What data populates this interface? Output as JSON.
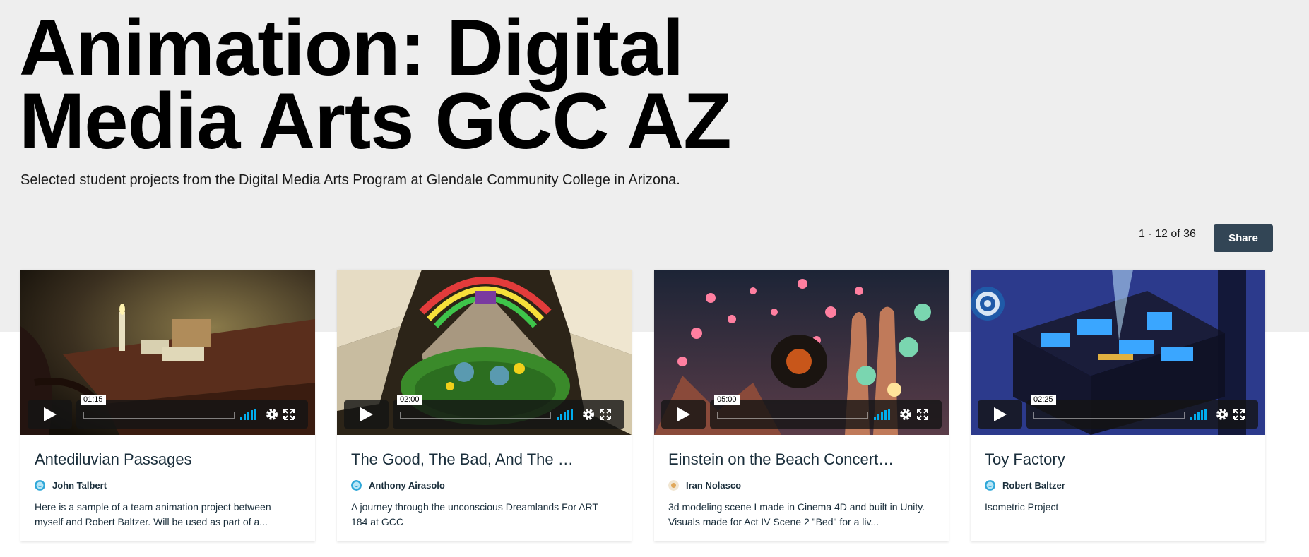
{
  "page": {
    "title": "Animation: Digital Media Arts GCC AZ",
    "description": "Selected student projects from the Digital Media Arts Program at Glendale Community College in Arizona."
  },
  "pagination": {
    "label": "1 - 12 of 36"
  },
  "share": {
    "label": "Share"
  },
  "colors": {
    "accent": "#324555",
    "hero_bg": "#eeeeee",
    "volume": "#00adef"
  },
  "videos": [
    {
      "title": "Antediluvian Passages",
      "author": "John Talbert",
      "duration": "01:15",
      "description": "Here is a sample of a team animation project between myself and Robert Baltzer. Will be used as part of a...",
      "avatar_icon": "blue-face-avatar-icon"
    },
    {
      "title": "The Good, The Bad, And The …",
      "author": "Anthony Airasolo",
      "duration": "02:00",
      "description": "A journey through the unconscious Dreamlands For ART 184 at GCC",
      "avatar_icon": "blue-face-avatar-icon"
    },
    {
      "title": "Einstein on the Beach Concert…",
      "author": "Iran Nolasco",
      "duration": "05:00",
      "description": "3d modeling scene I made in Cinema 4D and built in Unity. Visuals made for Act IV Scene 2 \"Bed\" for a liv...",
      "avatar_icon": "photo-avatar-icon"
    },
    {
      "title": "Toy Factory",
      "author": "Robert Baltzer",
      "duration": "02:25",
      "description": "Isometric Project",
      "avatar_icon": "blue-face-avatar-icon"
    }
  ]
}
